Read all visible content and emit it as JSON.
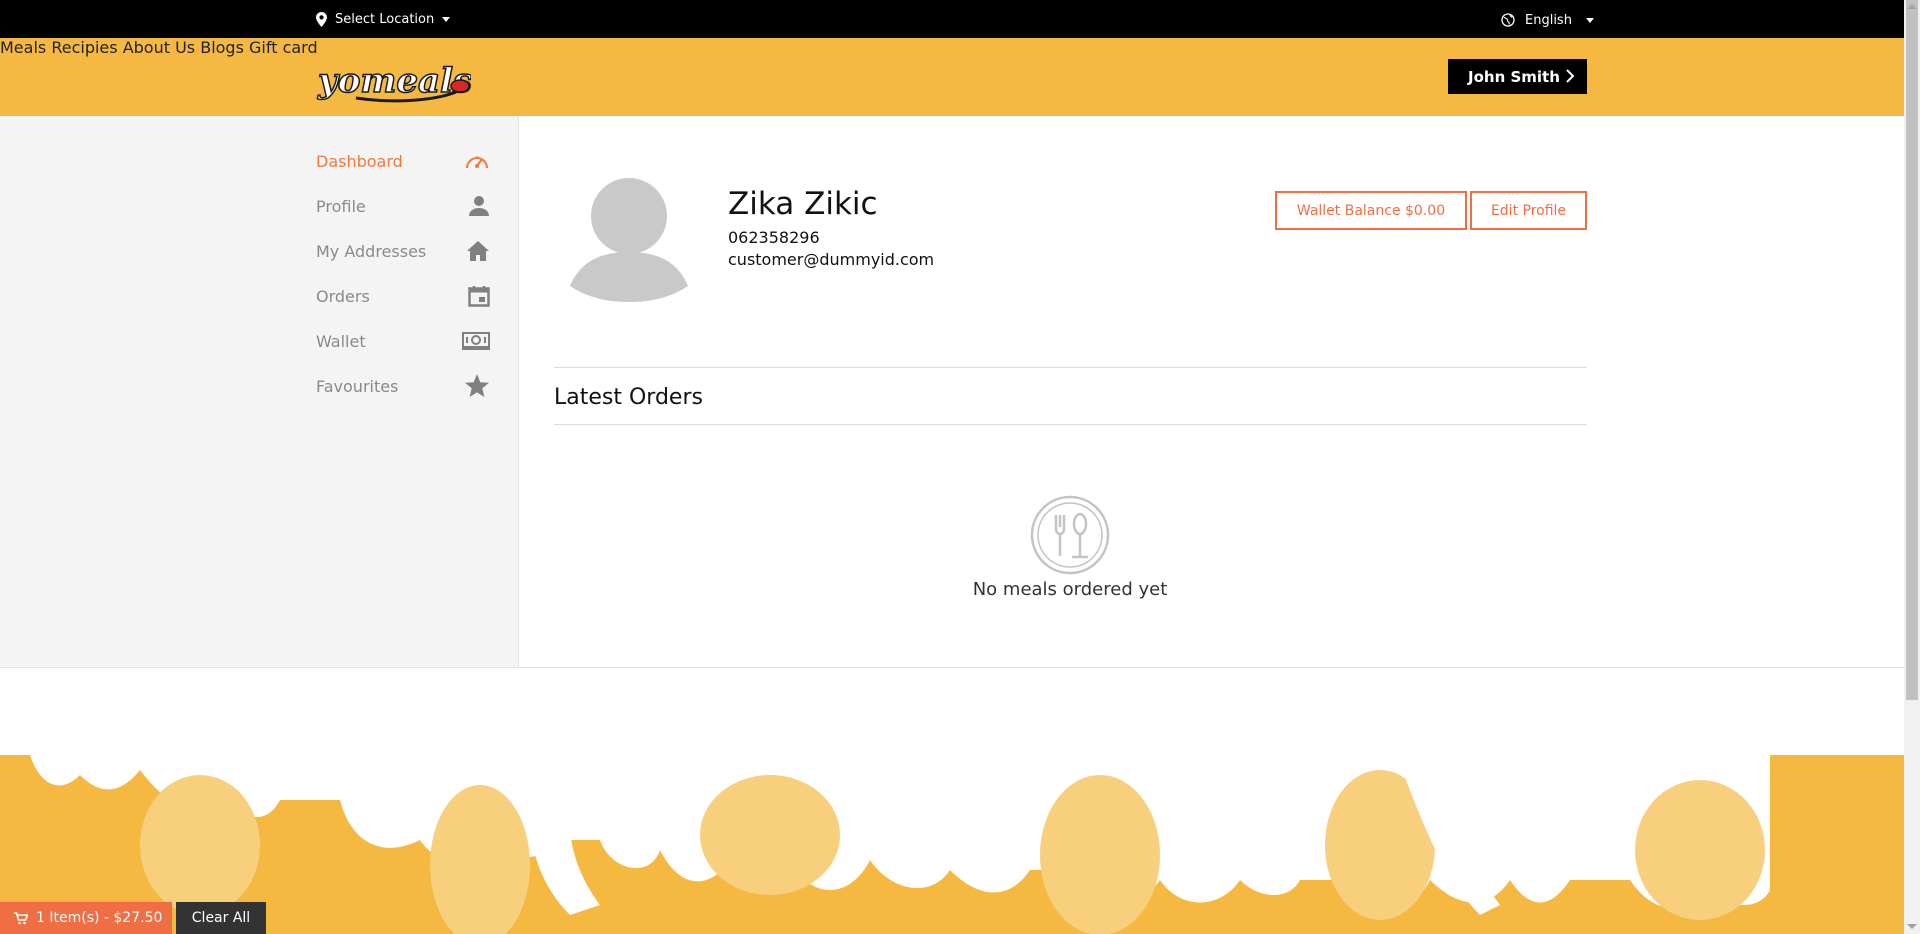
{
  "topbar": {
    "location_label": "Select Location",
    "language_label": "English"
  },
  "header": {
    "logo_text": "yomeals",
    "nav": [
      "Meals",
      "Recipies",
      "About Us",
      "Blogs",
      "Gift card"
    ],
    "user_button": "John Smith"
  },
  "sidebar": {
    "items": [
      {
        "label": "Dashboard",
        "icon": "speedometer-icon",
        "active": true
      },
      {
        "label": "Profile",
        "icon": "person-icon",
        "active": false
      },
      {
        "label": "My Addresses",
        "icon": "home-icon",
        "active": false
      },
      {
        "label": "Orders",
        "icon": "calendar-icon",
        "active": false
      },
      {
        "label": "Wallet",
        "icon": "money-icon",
        "active": false
      },
      {
        "label": "Favourites",
        "icon": "star-icon",
        "active": false
      }
    ]
  },
  "profile": {
    "name": "Zika Zikic",
    "phone": "062358296",
    "email": "customer@dummyid.com",
    "wallet_button": "Wallet Balance $0.00",
    "edit_button": "Edit Profile"
  },
  "orders": {
    "heading": "Latest Orders",
    "empty_text": "No meals ordered yet"
  },
  "cart": {
    "summary": "1 Item(s) - $27.50",
    "clear_label": "Clear All"
  },
  "colors": {
    "accent": "#ef6e44",
    "header_yellow": "#f5b841",
    "topbar": "#000000",
    "sidebar_bg": "#f4f4f4"
  }
}
